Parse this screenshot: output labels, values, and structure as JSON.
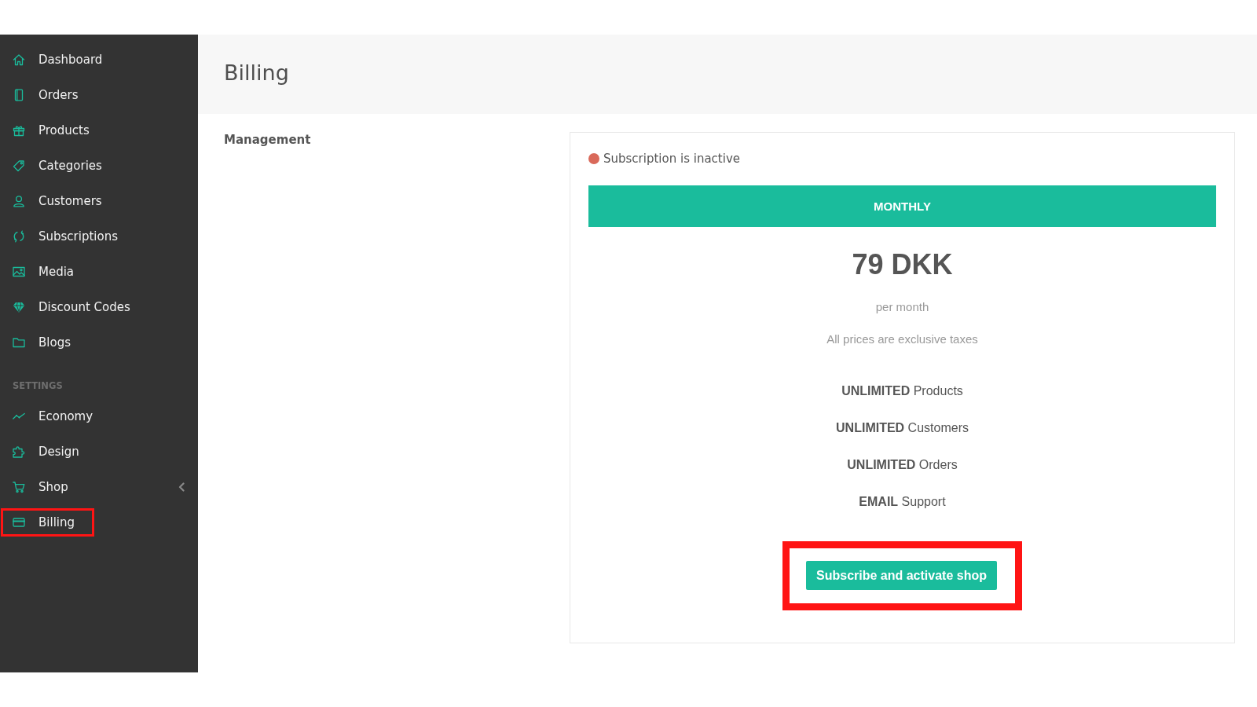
{
  "sidebar": {
    "sections": [
      {
        "items": [
          {
            "label": "Dashboard",
            "has_submenu": false,
            "highlighted": false
          },
          {
            "label": "Orders",
            "has_submenu": false,
            "highlighted": false
          },
          {
            "label": "Products",
            "has_submenu": false,
            "highlighted": false
          },
          {
            "label": "Categories",
            "has_submenu": false,
            "highlighted": false
          },
          {
            "label": "Customers",
            "has_submenu": false,
            "highlighted": false
          },
          {
            "label": "Subscriptions",
            "has_submenu": false,
            "highlighted": false
          },
          {
            "label": "Media",
            "has_submenu": false,
            "highlighted": false
          },
          {
            "label": "Discount Codes",
            "has_submenu": false,
            "highlighted": false
          },
          {
            "label": "Blogs",
            "has_submenu": false,
            "highlighted": false
          }
        ]
      },
      {
        "heading": "SETTINGS",
        "items": [
          {
            "label": "Economy",
            "has_submenu": false,
            "highlighted": false
          },
          {
            "label": "Design",
            "has_submenu": false,
            "highlighted": false
          },
          {
            "label": "Shop",
            "has_submenu": true,
            "highlighted": false
          },
          {
            "label": "Billing",
            "has_submenu": false,
            "highlighted": true
          }
        ]
      }
    ]
  },
  "header": {
    "title": "Billing"
  },
  "section_label": "Management",
  "plan": {
    "status": {
      "active": false,
      "text": "Subscription is inactive"
    },
    "name": "MONTHLY",
    "price": "79 DKK",
    "period": "per month",
    "tax_note": "All prices are exclusive taxes",
    "features": [
      "**UNLIMITED** Products",
      "**UNLIMITED** Customers",
      "**UNLIMITED** Orders",
      "**EMAIL** Support"
    ],
    "subscribe_button": {
      "label": "Subscribe and activate shop",
      "highlighted": true
    }
  }
}
